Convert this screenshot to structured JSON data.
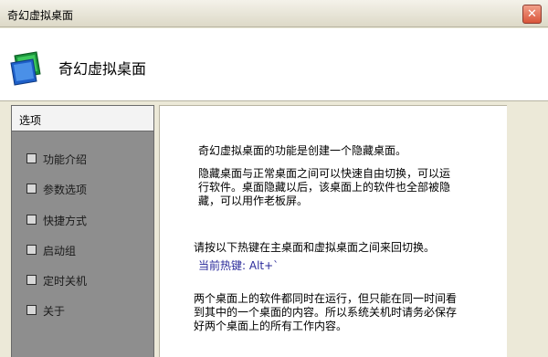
{
  "window": {
    "title": "奇幻虚拟桌面",
    "close_label": "✕"
  },
  "header": {
    "title": "奇幻虚拟桌面",
    "icon": "monitor-screens-icon"
  },
  "sidebar": {
    "heading": "选项",
    "items": [
      {
        "label": "功能介绍"
      },
      {
        "label": "参数选项"
      },
      {
        "label": "快捷方式"
      },
      {
        "label": "启动组"
      },
      {
        "label": "定时关机"
      },
      {
        "label": "关于"
      }
    ]
  },
  "content": {
    "intro": "奇幻虚拟桌面的功能是创建一个隐藏桌面。",
    "desc_line1": "隐藏桌面与正常桌面之间可以快速自由切换，可以运",
    "desc_line2": "行软件。桌面隐藏以后，该桌面上的软件也全部被隐",
    "desc_line3": "藏，可以用作老板屏。",
    "hotkey_tip": "请按以下热键在主桌面和虚拟桌面之间来回切换。",
    "hotkey_current": "当前热键: Alt+`",
    "note_line1": "两个桌面上的软件都同时在运行，但只能在同一时间看",
    "note_line2": "到其中的一个桌面的内容。所以系统关机时请务必保存",
    "note_line3": "好两个桌面上的所有工作内容。"
  },
  "colors": {
    "sidebar_bg": "#8e8e8e",
    "header_bg": "#ffffff",
    "window_bg": "#ece9d8",
    "hotkey_color": "#2a2a9a"
  }
}
